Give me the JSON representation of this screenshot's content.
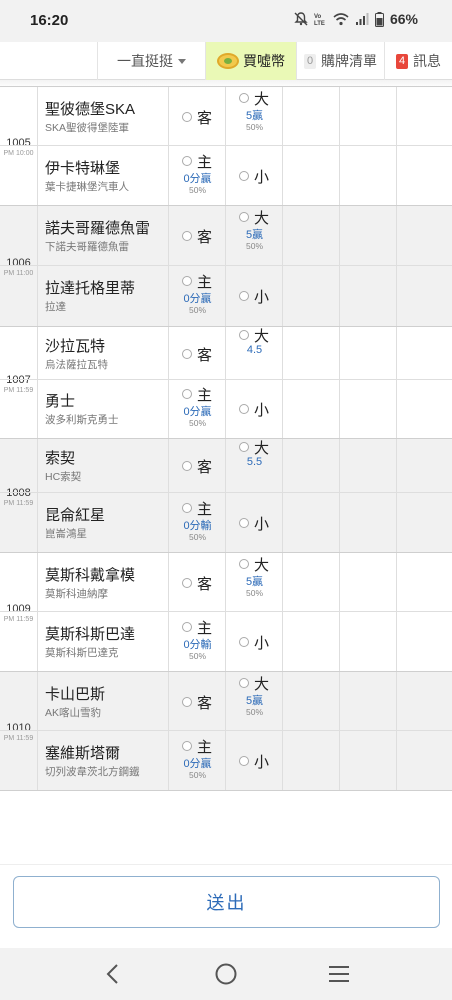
{
  "status_bar": {
    "time": "16:20",
    "battery": "66%",
    "icons": [
      "mute-bell-icon",
      "volte-icon",
      "wifi-icon",
      "signal-icon",
      "battery-icon"
    ]
  },
  "topbar": {
    "dropdown_label": "一直挺挺",
    "coin_label": "買噓幣",
    "bet_list_count": "0",
    "bet_list_label": "購牌清單",
    "messages_count": "4",
    "messages_label": "訊息"
  },
  "matches": [
    {
      "id": "1005",
      "time": "PM 10:00",
      "away": {
        "name": "聖彼德堡SKA",
        "sub": "SKA聖彼得堡陸軍",
        "side": "客"
      },
      "home": {
        "name": "伊卡特琳堡",
        "sub": "葉卡捷琳堡汽車人",
        "side": "主",
        "odds": "0分贏",
        "pct": "50%"
      },
      "over": {
        "label": "大",
        "odds": "5贏",
        "pct": "50%"
      },
      "under": {
        "label": "小"
      }
    },
    {
      "id": "1006",
      "time": "PM 11:00",
      "away": {
        "name": "諾夫哥羅德魚雷",
        "sub": "下諾夫哥羅德魚雷",
        "side": "客"
      },
      "home": {
        "name": "拉達托格里蒂",
        "sub": "拉達",
        "side": "主",
        "odds": "0分贏",
        "pct": "50%"
      },
      "over": {
        "label": "大",
        "odds": "5贏",
        "pct": "50%"
      },
      "under": {
        "label": "小"
      }
    },
    {
      "id": "1007",
      "time": "PM 11:59",
      "away": {
        "name": "沙拉瓦特",
        "sub": "烏法薩拉瓦特",
        "side": "客"
      },
      "home": {
        "name": "勇士",
        "sub": "波多利斯克勇士",
        "side": "主",
        "odds": "0分贏",
        "pct": "50%"
      },
      "over": {
        "label": "大",
        "odds": "4.5",
        "pct": ""
      },
      "under": {
        "label": "小"
      }
    },
    {
      "id": "1008",
      "time": "PM 11:59",
      "away": {
        "name": "索契",
        "sub": "HC索契",
        "side": "客"
      },
      "home": {
        "name": "昆侖紅星",
        "sub": "崑崙鴻星",
        "side": "主",
        "odds": "0分輸",
        "pct": "50%"
      },
      "over": {
        "label": "大",
        "odds": "5.5",
        "pct": ""
      },
      "under": {
        "label": "小"
      }
    },
    {
      "id": "1009",
      "time": "PM 11:59",
      "away": {
        "name": "莫斯科戴拿模",
        "sub": "莫斯科迪納摩",
        "side": "客"
      },
      "home": {
        "name": "莫斯科斯巴達",
        "sub": "莫斯科斯巴達克",
        "side": "主",
        "odds": "0分輸",
        "pct": "50%"
      },
      "over": {
        "label": "大",
        "odds": "5贏",
        "pct": "50%"
      },
      "under": {
        "label": "小"
      }
    },
    {
      "id": "1010",
      "time": "PM 11:59",
      "away": {
        "name": "卡山巴斯",
        "sub": "AK喀山雪豹",
        "side": "客"
      },
      "home": {
        "name": "塞維斯塔爾",
        "sub": "切列波韋茨北方鋼鐵",
        "side": "主",
        "odds": "0分贏",
        "pct": "50%"
      },
      "over": {
        "label": "大",
        "odds": "5贏",
        "pct": "50%"
      },
      "under": {
        "label": "小"
      }
    }
  ],
  "submit_label": "送出",
  "nav": {
    "back": "back-icon",
    "home": "home-icon",
    "menu": "menu-icon"
  }
}
